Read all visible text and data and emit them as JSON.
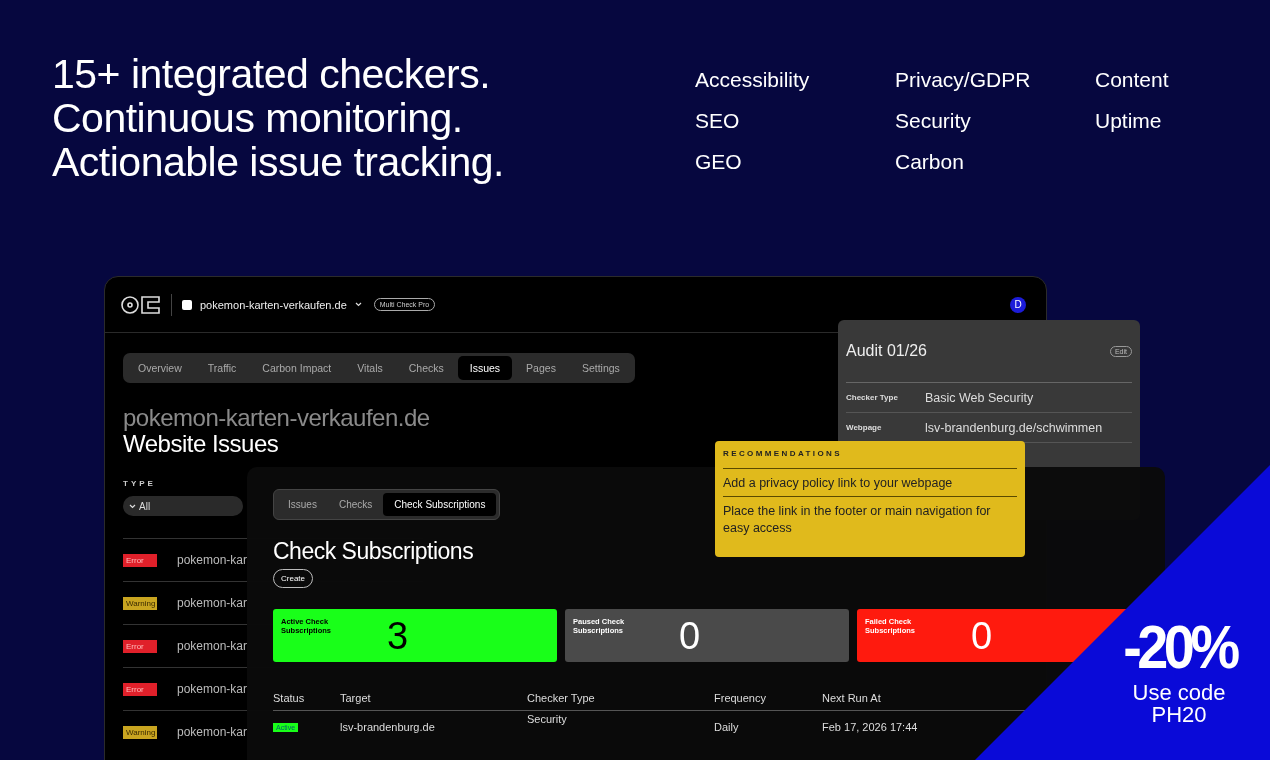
{
  "headline": [
    "15+ integrated checkers.",
    "Continuous monitoring.",
    "Actionable issue tracking."
  ],
  "features": [
    [
      "Accessibility",
      "SEO",
      "GEO"
    ],
    [
      "Privacy/GDPR",
      "Security",
      "Carbon"
    ],
    [
      "Content",
      "Uptime"
    ]
  ],
  "app": {
    "site": "pokemon-karten-verkaufen.de",
    "plan": "Multi Check Pro",
    "avatar": "D",
    "tabs": [
      {
        "label": "Overview",
        "selected": false
      },
      {
        "label": "Traffic",
        "selected": false
      },
      {
        "label": "Carbon Impact",
        "selected": false
      },
      {
        "label": "Vitals",
        "selected": false
      },
      {
        "label": "Checks",
        "selected": false
      },
      {
        "label": "Issues",
        "selected": true
      },
      {
        "label": "Pages",
        "selected": false
      },
      {
        "label": "Settings",
        "selected": false
      }
    ],
    "title": "pokemon-karten-verkaufen.de",
    "subtitle": "Website Issues",
    "filter": {
      "label": "TYPE",
      "value": "All"
    },
    "issues": [
      {
        "kind": "error",
        "badge": "Error",
        "site": "pokemon-kar"
      },
      {
        "kind": "warning",
        "badge": "Warning",
        "site": "pokemon-kar"
      },
      {
        "kind": "error",
        "badge": "Error",
        "site": "pokemon-kar"
      },
      {
        "kind": "error",
        "badge": "Error",
        "site": "pokemon-kar"
      },
      {
        "kind": "warning",
        "badge": "Warning",
        "site": "pokemon-kar"
      }
    ]
  },
  "audit": {
    "title": "Audit 01/26",
    "edit": "Edit",
    "rows": [
      {
        "label": "Checker Type",
        "value": "Basic Web Security"
      },
      {
        "label": "Webpage",
        "value": "lsv-brandenburg.de/schwimmen"
      }
    ]
  },
  "recommendations": {
    "heading": "RECOMMENDATIONS",
    "items": [
      "Add a privacy policy link to your webpage",
      "Place the link in the footer or main navigation for easy access"
    ]
  },
  "subscriptions": {
    "tabs": [
      {
        "label": "Issues",
        "selected": false
      },
      {
        "label": "Checks",
        "selected": false
      },
      {
        "label": "Check Subscriptions",
        "selected": true
      }
    ],
    "title": "Check Subscriptions",
    "create": "Create",
    "cards": [
      {
        "kind": "active",
        "label": "Active Check Subscriptions",
        "count": "3"
      },
      {
        "kind": "paused",
        "label": "Paused Check Subscriptions",
        "count": "0"
      },
      {
        "kind": "failed",
        "label": "Failed Check Subscriptions",
        "count": "0"
      }
    ],
    "columns": [
      "Status",
      "Target",
      "Checker Type",
      "Frequency",
      "Next Run At"
    ],
    "rows": [
      {
        "status": "Active",
        "kind": "active",
        "target": "lsv-brandenburg.de",
        "checker": "Security",
        "frequency": "Daily",
        "next_run": "Feb 17, 2026 17:44"
      }
    ]
  },
  "promo": {
    "discount": "-20%",
    "line1": "Use code",
    "line2": "PH20"
  }
}
